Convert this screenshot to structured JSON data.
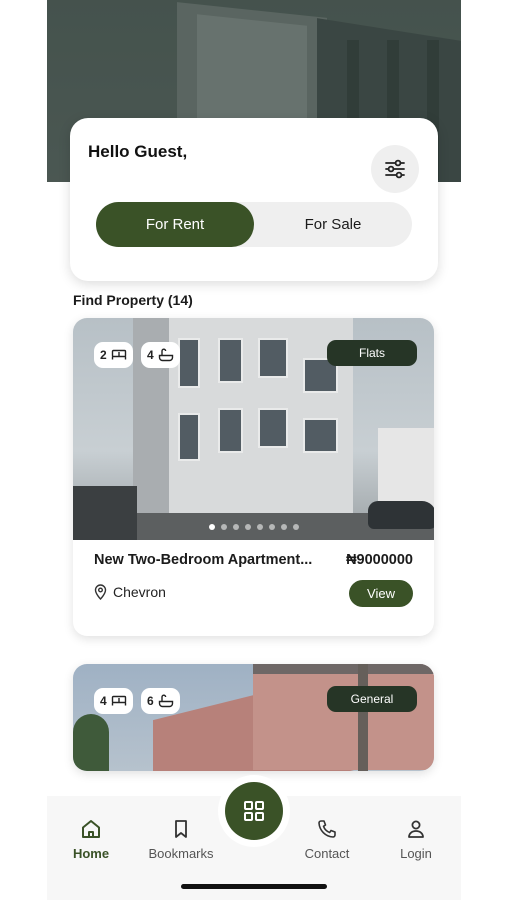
{
  "greeting": "Hello Guest,",
  "toggle": {
    "rent_label": "For Rent",
    "sale_label": "For Sale",
    "selected": "For Rent"
  },
  "section_title": "Find Property (14)",
  "properties": [
    {
      "bedrooms": "2",
      "bathrooms": "4",
      "tag": "Flats",
      "title": "New Two-Bedroom Apartment...",
      "price": "₦9000000",
      "location": "Chevron",
      "view_label": "View",
      "carousel_dots": 8,
      "active_dot": 0
    },
    {
      "bedrooms": "4",
      "bathrooms": "6",
      "tag": "General"
    }
  ],
  "nav": {
    "home": "Home",
    "bookmarks": "Bookmarks",
    "contact": "Contact",
    "login": "Login"
  },
  "colors": {
    "accent": "#3a5227",
    "tag_bg": "#263526"
  }
}
